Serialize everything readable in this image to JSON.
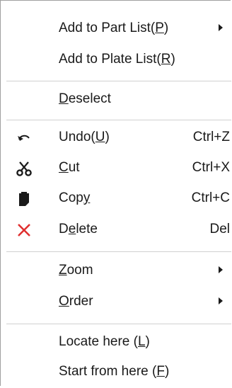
{
  "menu": {
    "items": [
      {
        "pre": "Add to Part List(",
        "acc": "P",
        "post": ")",
        "shortcut": "",
        "submenu": true
      },
      {
        "pre": "Add to Plate List(",
        "acc": "R",
        "post": ")",
        "shortcut": "",
        "submenu": false
      },
      {
        "pre": "",
        "acc": "D",
        "post": "eselect",
        "shortcut": "",
        "submenu": false
      },
      {
        "pre": "Undo(",
        "acc": "U",
        "post": ")",
        "shortcut": "Ctrl+Z",
        "icon": "undo-icon",
        "submenu": false
      },
      {
        "pre": "",
        "acc": "C",
        "post": "ut",
        "shortcut": "Ctrl+X",
        "icon": "scissors-icon",
        "submenu": false
      },
      {
        "pre": "Cop",
        "acc": "y",
        "post": "",
        "shortcut": "Ctrl+C",
        "icon": "copy-icon",
        "submenu": false
      },
      {
        "pre": "D",
        "acc": "e",
        "post": "lete",
        "shortcut": "Del",
        "icon": "delete-icon",
        "submenu": false
      },
      {
        "pre": "",
        "acc": "Z",
        "post": "oom",
        "shortcut": "",
        "submenu": true
      },
      {
        "pre": "",
        "acc": "O",
        "post": "rder",
        "shortcut": "",
        "submenu": true
      },
      {
        "pre": "Locate here (",
        "acc": "L",
        "post": ")",
        "shortcut": "",
        "submenu": false
      },
      {
        "pre": "Start from here (",
        "acc": "F",
        "post": ")",
        "shortcut": "",
        "submenu": false
      }
    ]
  },
  "colors": {
    "delete_icon": "#e03030",
    "text": "#1a1a1a",
    "separator": "#d0d0d0"
  }
}
